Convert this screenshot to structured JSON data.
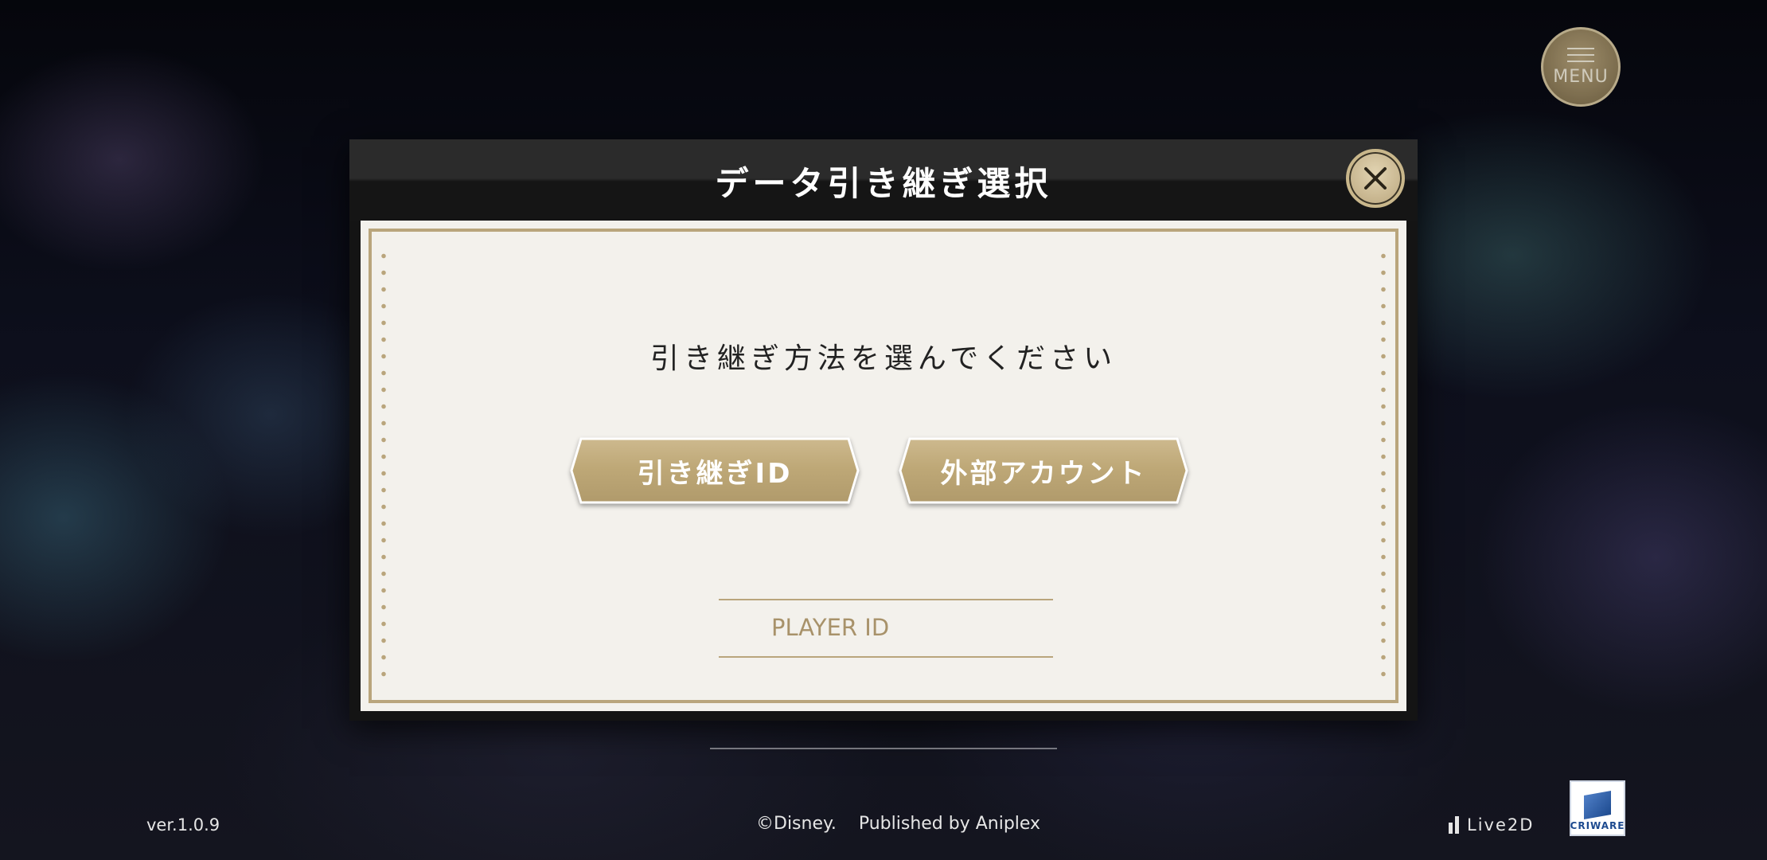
{
  "menu": {
    "label": "MENU"
  },
  "dialog": {
    "title": "データ引き継ぎ選択",
    "prompt": "引き継ぎ方法を選んでください",
    "buttons": {
      "transfer_id": "引き継ぎID",
      "external_account": "外部アカウント"
    },
    "player_id_label": "PLAYER ID"
  },
  "footer": {
    "version": "ver.1.0.9",
    "copyright": "©Disney.    Published by Aniplex",
    "live2d": "Live2D",
    "criware": "CRIWARE"
  },
  "colors": {
    "gold": "#b9a57c",
    "gold_button": "#bfa97c",
    "panel": "#f3f1ec",
    "header": "#141414"
  },
  "icons": {
    "menu": "hamburger-icon",
    "close": "close-icon",
    "live2d": "live2d-logo",
    "criware": "criware-logo"
  }
}
